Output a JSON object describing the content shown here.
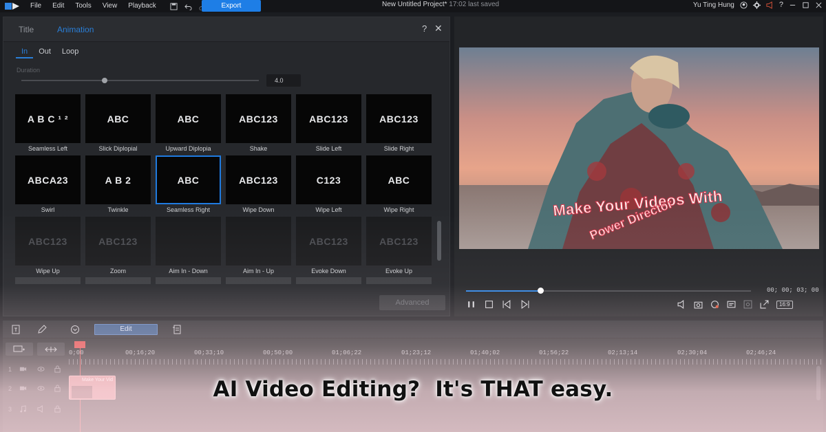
{
  "menu": {
    "items": [
      "File",
      "Edit",
      "Tools",
      "View",
      "Playback"
    ],
    "export_label": "Export",
    "project_title": "New Untitled Project*",
    "saved_status": "17:02 last saved",
    "user_name": "Yu Ting Hung"
  },
  "designer": {
    "tabs": {
      "title": "Title",
      "animation": "Animation"
    },
    "help": "?",
    "close": "✕",
    "subtabs": [
      "In",
      "Out",
      "Loop"
    ],
    "duration_label": "Duration",
    "duration_value": "4.0",
    "duration_fraction": 0.35,
    "effects": [
      {
        "label": "Seamless Left",
        "preview": "A B C ¹ ²"
      },
      {
        "label": "Slick Diplopial",
        "preview": "ABC"
      },
      {
        "label": "Upward Diplopia",
        "preview": "ABC"
      },
      {
        "label": "Shake",
        "preview": "ABC123"
      },
      {
        "label": "Slide Left",
        "preview": "ABC123"
      },
      {
        "label": "Slide Right",
        "preview": "ABC123"
      },
      {
        "label": "Swirl",
        "preview": "ABCA23"
      },
      {
        "label": "Twinkle",
        "preview": "A B   2"
      },
      {
        "label": "Seamless Right",
        "preview": "ABC"
      },
      {
        "label": "Wipe Down",
        "preview": "ABC123"
      },
      {
        "label": "Wipe Left",
        "preview": "C123"
      },
      {
        "label": "Wipe Right",
        "preview": "ABC"
      },
      {
        "label": "Wipe Up",
        "preview": "ABC123"
      },
      {
        "label": "Zoom",
        "preview": "ABC123"
      },
      {
        "label": "Aim In - Down",
        "preview": ""
      },
      {
        "label": "Aim In - Up",
        "preview": ""
      },
      {
        "label": "Evoke Down",
        "preview": "ABC123"
      },
      {
        "label": "Evoke Up",
        "preview": "ABC123"
      }
    ],
    "selected_effect": "Seamless Right",
    "advanced_label": "Advanced"
  },
  "preview": {
    "overlay_line1": "Make Your Videos With",
    "overlay_line2": "Power Director",
    "timecode": "00; 00; 03; 00",
    "aspect_ratio": "16:9",
    "progress_fraction": 0.26
  },
  "timeline": {
    "edit_label": "Edit",
    "ruler_labels": [
      "0;00",
      "00;16;20",
      "00;33;10",
      "00;50;00",
      "01;06;22",
      "01;23;12",
      "01;40;02",
      "01;56;22",
      "02;13;14",
      "02;30;04",
      "02;46;24"
    ],
    "tracks": [
      "1",
      "2",
      "3"
    ],
    "clip_label": "Make Your Vid"
  },
  "caption": "AI Video Editing?  It's THAT easy.",
  "colors": {
    "accent": "#1e7ee6",
    "overlay_stroke": "#d8364c",
    "pink_wash": "#ffdde4"
  }
}
